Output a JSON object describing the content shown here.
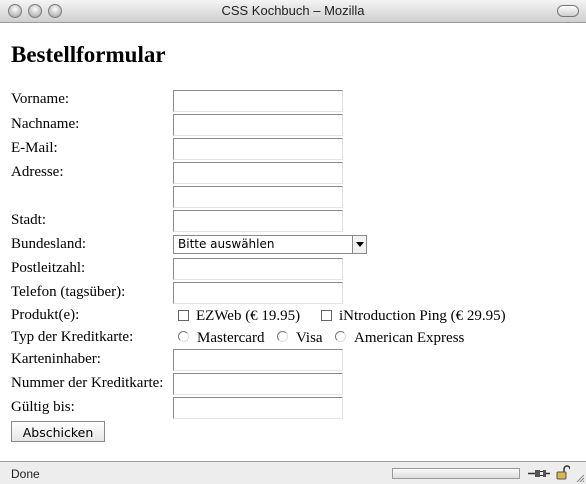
{
  "window": {
    "title": "CSS Kochbuch – Mozilla",
    "buttons": [
      "close-icon",
      "minimize-icon",
      "zoom-icon"
    ]
  },
  "page": {
    "heading": "Bestellformular",
    "fields": {
      "vorname": {
        "label": "Vorname:",
        "value": ""
      },
      "nachname": {
        "label": "Nachname:",
        "value": ""
      },
      "email": {
        "label": "E-Mail:",
        "value": ""
      },
      "adresse": {
        "label": "Adresse:",
        "value": "",
        "value2": ""
      },
      "stadt": {
        "label": "Stadt:",
        "value": ""
      },
      "bundesland": {
        "label": "Bundesland:",
        "selected": "Bitte auswählen"
      },
      "plz": {
        "label": "Postleitzahl:",
        "value": ""
      },
      "telefon": {
        "label": "Telefon (tagsüber):",
        "value": ""
      },
      "produkte": {
        "label": "Produkt(e):",
        "options": [
          "EZWeb (€ 19.95)",
          "iNtroduction Ping (€ 29.95)"
        ]
      },
      "kreditkarte_typ": {
        "label": "Typ der Kreditkarte:",
        "options": [
          "Mastercard",
          "Visa",
          "American Express"
        ]
      },
      "karteninhaber": {
        "label": "Karteninhaber:",
        "value": ""
      },
      "kartennummer": {
        "label": "Nummer der Kreditkarte:",
        "value": ""
      },
      "gueltig": {
        "label": "Gültig bis:",
        "value": ""
      }
    },
    "submit_label": "Abschicken"
  },
  "statusbar": {
    "text": "Done",
    "icons": [
      "plug-icon",
      "lock-icon"
    ]
  }
}
